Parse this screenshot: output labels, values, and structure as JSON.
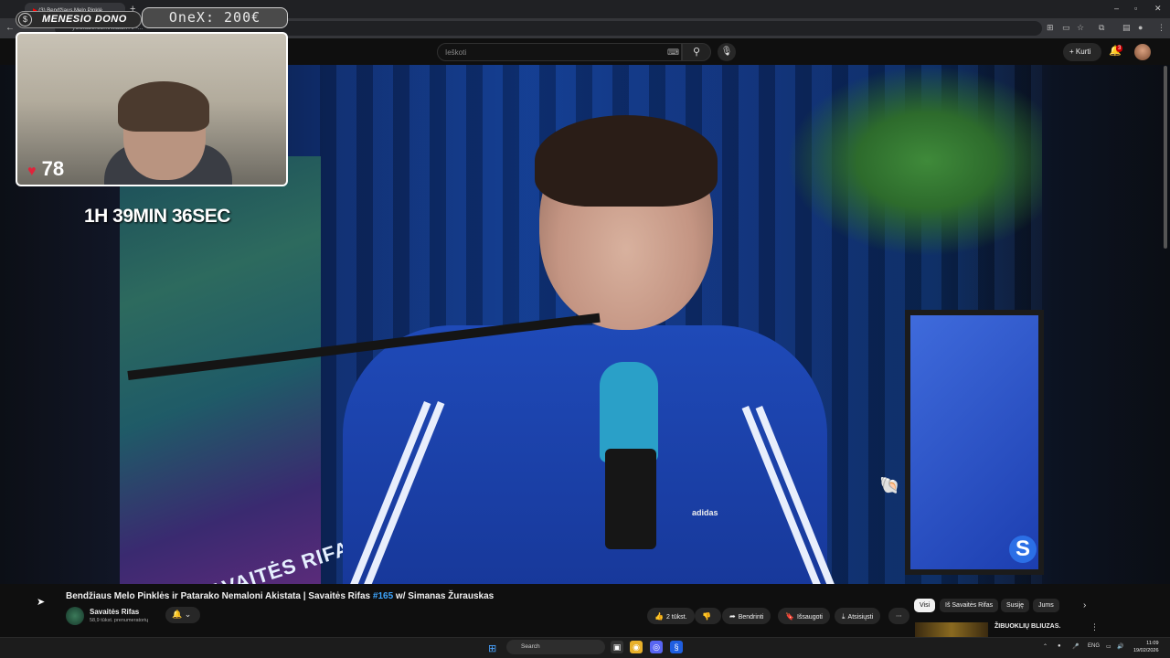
{
  "browser": {
    "tab_title": "(3) Bendžiaus Melo Pinklė",
    "new_tab": "+",
    "url": "youtube.com/watch?v=...",
    "window_controls": [
      "–",
      "▫",
      "✕"
    ]
  },
  "youtube": {
    "search_placeholder": "Ieškoti",
    "create_label": "Kurti",
    "notification_count": "3"
  },
  "overlay": {
    "donation_label": "MENESIO DONO",
    "top_donor": "OneX: 200€",
    "likes": "78",
    "timer": "1H 39MIN 36SEC"
  },
  "video_scene": {
    "poster_text": "SAVAITĖS RIFAS",
    "brand": "adidas",
    "channel_logo": "S"
  },
  "video": {
    "title_main": "Bendžiaus Melo Pinklės ir Patarako Nemaloni Akistata | Savaitės Rifas ",
    "title_hashtag": "#165",
    "title_rest": " w/ Simanas Žurauskas",
    "channel_name": "Savaitės Rifas",
    "subscribers": "58,9 tūkst. prenumeratorių",
    "actions": {
      "likes": "2 tūkst.",
      "share": "Bendrinti",
      "save": "Išsaugoti",
      "download": "Atsisiųsti",
      "more": "⋯"
    }
  },
  "chips": [
    "Visi",
    "Iš Savaitės Rifas",
    "Susiję",
    "Jums"
  ],
  "recommendation": {
    "title": "ŽIBUOKLIŲ BLIUZAS."
  },
  "taskbar": {
    "search_label": "Search",
    "language": "ENG",
    "time": "11:09",
    "date": "19/02/2026"
  },
  "colors": {
    "yt_background": "#0f0f0f",
    "hashtag_blue": "#3ea6ff",
    "heart_red": "#e0233b"
  }
}
